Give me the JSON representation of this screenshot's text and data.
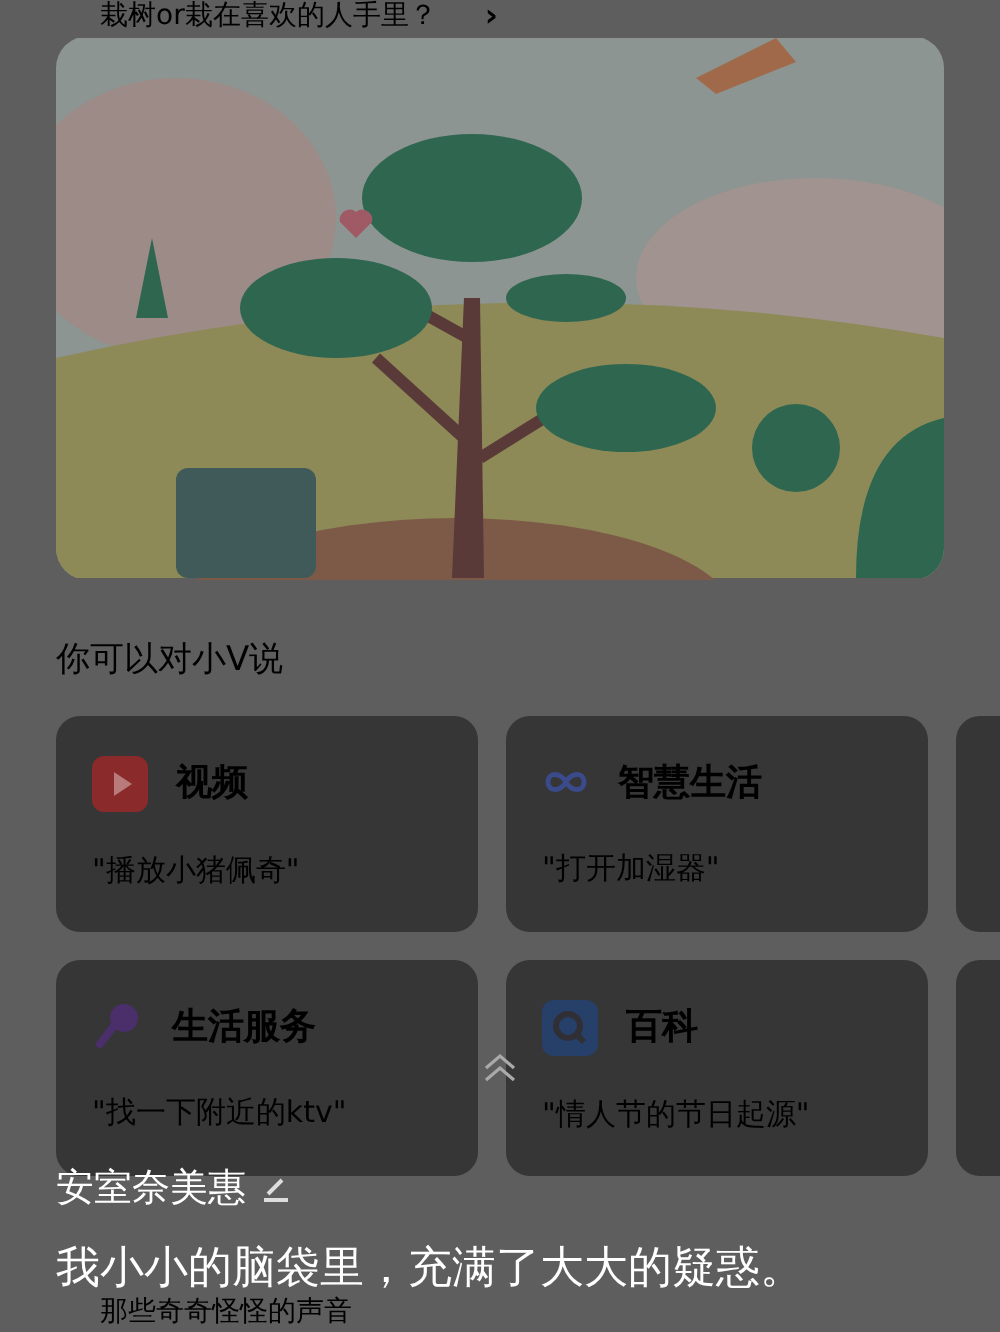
{
  "banner": {
    "title": "栽树or栽在喜欢的人手里？",
    "chevron": "›"
  },
  "suggestions": {
    "heading": "你可以对小V说",
    "cards": [
      {
        "kind": "video",
        "title": "视频",
        "example": "\"播放小猪佩奇\""
      },
      {
        "kind": "smart",
        "title": "智慧生活",
        "example": "\"打开加湿器\""
      },
      {
        "kind": "service",
        "title": "生活服务",
        "example": "\"找一下附近的ktv\""
      },
      {
        "kind": "wiki",
        "title": "百科",
        "example": "\"情人节的节日起源\""
      }
    ]
  },
  "overlay": {
    "author": "安室奈美惠",
    "caption": "我小小的脑袋里，充满了大大的疑惑。",
    "next_line": "那些奇奇怪怪的声音"
  }
}
